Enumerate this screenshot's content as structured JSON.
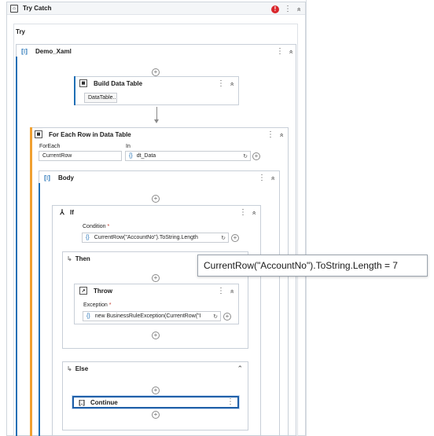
{
  "try_catch": {
    "title": "Try Catch"
  },
  "try": {
    "label": "Try"
  },
  "sequence": {
    "title": "Demo_Xaml"
  },
  "build_table": {
    "title": "Build Data Table",
    "button": "DataTable..."
  },
  "for_each": {
    "title": "For Each Row in Data Table",
    "foreach_label": "ForEach",
    "foreach_value": "CurrentRow",
    "in_label": "In",
    "in_value": "dt_Data"
  },
  "body": {
    "title": "Body"
  },
  "if_activity": {
    "title": "If",
    "condition_label": "Condition",
    "required_mark": "*",
    "condition_value": "CurrentRow(\"AccountNo\").ToString.Length"
  },
  "then_branch": {
    "title": "Then"
  },
  "throw_activity": {
    "title": "Throw",
    "exception_label": "Exception",
    "required_mark": "*",
    "exception_value": "new BusinessRuleException(CurrentRow(\"I"
  },
  "else_branch": {
    "title": "Else"
  },
  "continue_activity": {
    "title": "Continue"
  },
  "tooltip": {
    "text": "CurrentRow(\"AccountNo\").ToString.Length = 7"
  },
  "icons": {
    "vb_expression": "{}",
    "alert": "!",
    "more": "⋮",
    "collapse": "»",
    "plus": "+"
  },
  "colors": {
    "accent": "#f0a030",
    "sequence_bar": "#1f6fb5",
    "selected": "#1f5fa8",
    "alert": "#d9262b"
  }
}
